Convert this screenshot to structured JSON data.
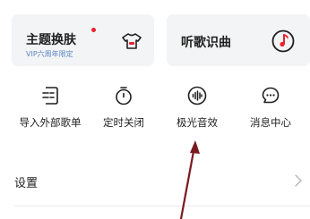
{
  "cards": {
    "theme": {
      "title": "主题换肤",
      "subtitle": "VIP六周年限定",
      "icon": "tshirt-icon",
      "badge_color": "#e8232d"
    },
    "recognize": {
      "title": "听歌识曲",
      "icon": "music-disc-icon"
    }
  },
  "tools": [
    {
      "label": "导入外部歌单",
      "icon": "import-list-icon"
    },
    {
      "label": "定时关闭",
      "icon": "timer-icon"
    },
    {
      "label": "极光音效",
      "icon": "sound-wave-icon"
    },
    {
      "label": "消息中心",
      "icon": "message-bubble-icon"
    }
  ],
  "settings": {
    "label": "设置",
    "icon": "chevron-right-icon"
  },
  "colors": {
    "card_bg": "#f3f4f6",
    "subtitle": "#5b86c3",
    "accent_red": "#e8232d",
    "annotation_arrow": "#7a1a1f"
  }
}
